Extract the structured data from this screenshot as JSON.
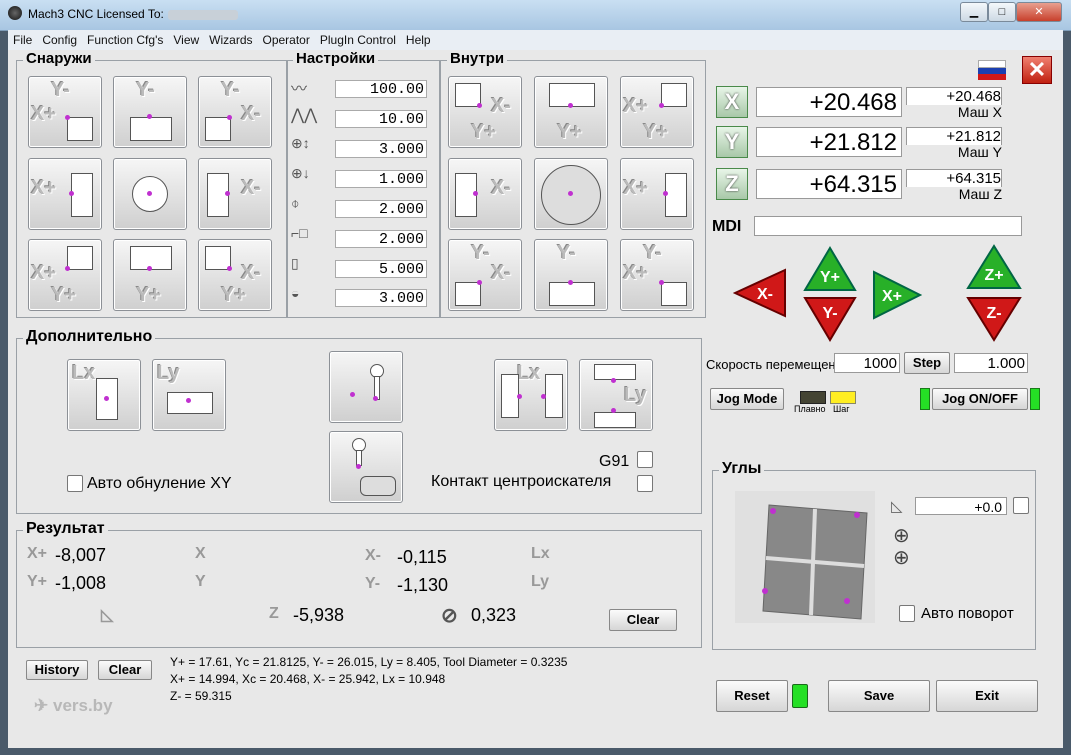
{
  "window": {
    "title": "Mach3 CNC  Licensed To:",
    "min": "▁",
    "max": "□",
    "close": "✕"
  },
  "menu": [
    "File",
    "Config",
    "Function Cfg's",
    "View",
    "Wizards",
    "Operator",
    "PlugIn Control",
    "Help"
  ],
  "groups": {
    "outside": "Снаружи",
    "settings": "Настройки",
    "inside": "Внутри",
    "additional": "Дополнительно",
    "result": "Результат",
    "angles": "Углы"
  },
  "settings_values": [
    "100.00",
    "10.00",
    "3.000",
    "1.000",
    "2.000",
    "2.000",
    "5.000",
    "3.000"
  ],
  "dro": {
    "x": {
      "label": "X",
      "value": "+20.468",
      "mach": "+20.468",
      "mach_label": "Маш X"
    },
    "y": {
      "label": "Y",
      "value": "+21.812",
      "mach": "+21.812",
      "mach_label": "Маш Y"
    },
    "z": {
      "label": "Z",
      "value": "+64.315",
      "mach": "+64.315",
      "mach_label": "Маш Z"
    }
  },
  "mdi": {
    "label": "MDI",
    "value": ""
  },
  "jog": {
    "x_minus": "X-",
    "x_plus": "X+",
    "y_plus": "Y+",
    "y_minus": "Y-",
    "z_plus": "Z+",
    "z_minus": "Z-",
    "speed_label": "Скорость перемещений",
    "speed_value": "1000",
    "step_label": "Step",
    "step_value": "1.000",
    "jog_mode": "Jog Mode",
    "smooth": "Плавно",
    "step_mode": "Шаг",
    "jog_onoff": "Jog ON/OFF"
  },
  "additional": {
    "auto_zero_xy": "Авто обнуление XY",
    "g91": "G91",
    "probe_contact": "Контакт центроискателя"
  },
  "result": {
    "xplus": "-8,007",
    "yplus": "-1,008",
    "xminus": "-0,115",
    "yminus": "-1,130",
    "z": "-5,938",
    "diameter": "0,323",
    "clear": "Clear",
    "xplus_icon": "X+",
    "yplus_icon": "Y+",
    "xminus_icon": "X-",
    "yminus_icon": "Y-",
    "lx_icon": "Lx",
    "ly_icon": "Ly",
    "xc_icon": "X",
    "yc_icon": "Y",
    "z_icon": "Z"
  },
  "angles": {
    "value": "+0.0",
    "auto_rotate": "Авто поворот"
  },
  "footer": {
    "history": "History",
    "clear": "Clear",
    "log_line1": "Y+ = 17.61, Yc = 21.8125, Y- = 26.015, Ly = 8.405, Tool Diameter =  0.3235",
    "log_line2": "X+ = 14.994, Xc = 20.468, X- = 25.942, Lx = 10.948",
    "log_line3": "Z- = 59.315",
    "logo": "vers.by",
    "reset": "Reset",
    "save": "Save",
    "exit": "Exit"
  },
  "colors": {
    "led_green": "#25e025",
    "jog_red": "#d01818",
    "jog_green": "#28b028",
    "accent_purple": "#c030d0"
  }
}
